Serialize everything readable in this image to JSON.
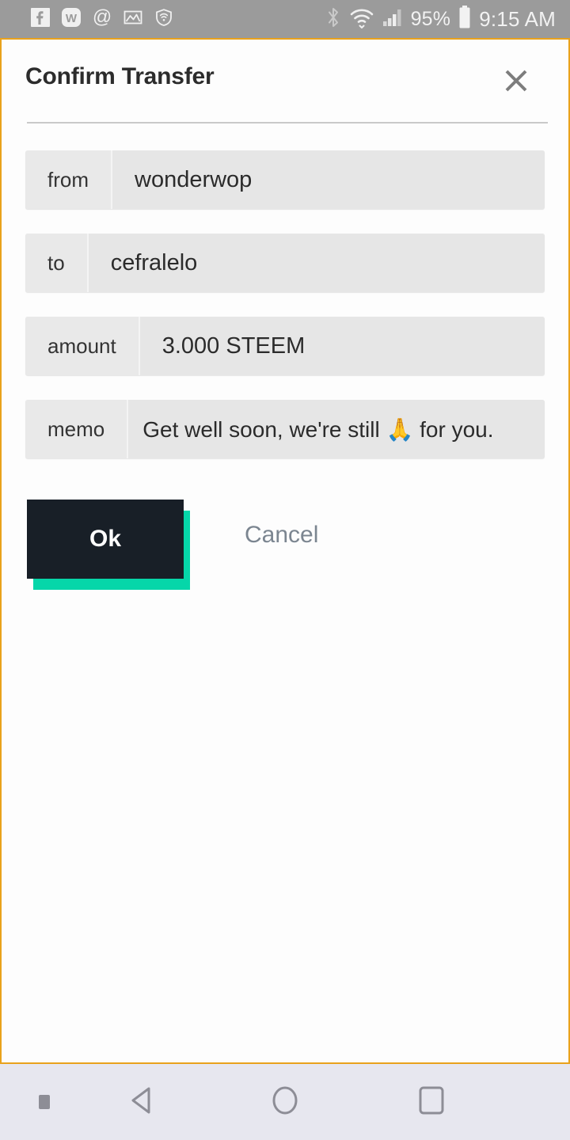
{
  "status_bar": {
    "background": "#9b9b9b",
    "left_icons": [
      {
        "name": "facebook-icon",
        "label": "f"
      },
      {
        "name": "wordpress-icon",
        "label": "W"
      },
      {
        "name": "email-at-icon",
        "label": "@"
      },
      {
        "name": "gallery-image-icon",
        "label": "image"
      },
      {
        "name": "vpn-shield-icon",
        "label": "shield"
      }
    ],
    "right_icons": [
      {
        "name": "bluetooth-icon",
        "label": "bluetooth"
      },
      {
        "name": "wifi-icon",
        "label": "wifi"
      },
      {
        "name": "cellular-signal-icon",
        "label": "signal"
      }
    ],
    "battery_percent": "95%",
    "battery_icon": "battery-icon",
    "clock": "9:15 AM"
  },
  "dialog": {
    "title": "Confirm Transfer",
    "close_icon": "close-icon",
    "border_color": "#e9a21c",
    "fields": [
      {
        "label": "from",
        "value": "wonderwop"
      },
      {
        "label": "to",
        "value": "cefralelo"
      },
      {
        "label": "amount",
        "value": "3.000 STEEM"
      },
      {
        "label": "memo",
        "value": "Get well soon, we're still 🙏 for you."
      }
    ],
    "actions": {
      "ok_label": "Ok",
      "ok_background": "#181f27",
      "ok_shadow_color": "#06d6a9",
      "cancel_label": "Cancel",
      "cancel_color": "#7b8590"
    }
  },
  "nav_bar": {
    "background": "#e7e7ef",
    "items": [
      {
        "name": "nav-indicator-dot",
        "label": "indicator"
      },
      {
        "name": "nav-back-icon",
        "label": "back"
      },
      {
        "name": "nav-home-icon",
        "label": "home"
      },
      {
        "name": "nav-recents-icon",
        "label": "recents"
      }
    ]
  }
}
